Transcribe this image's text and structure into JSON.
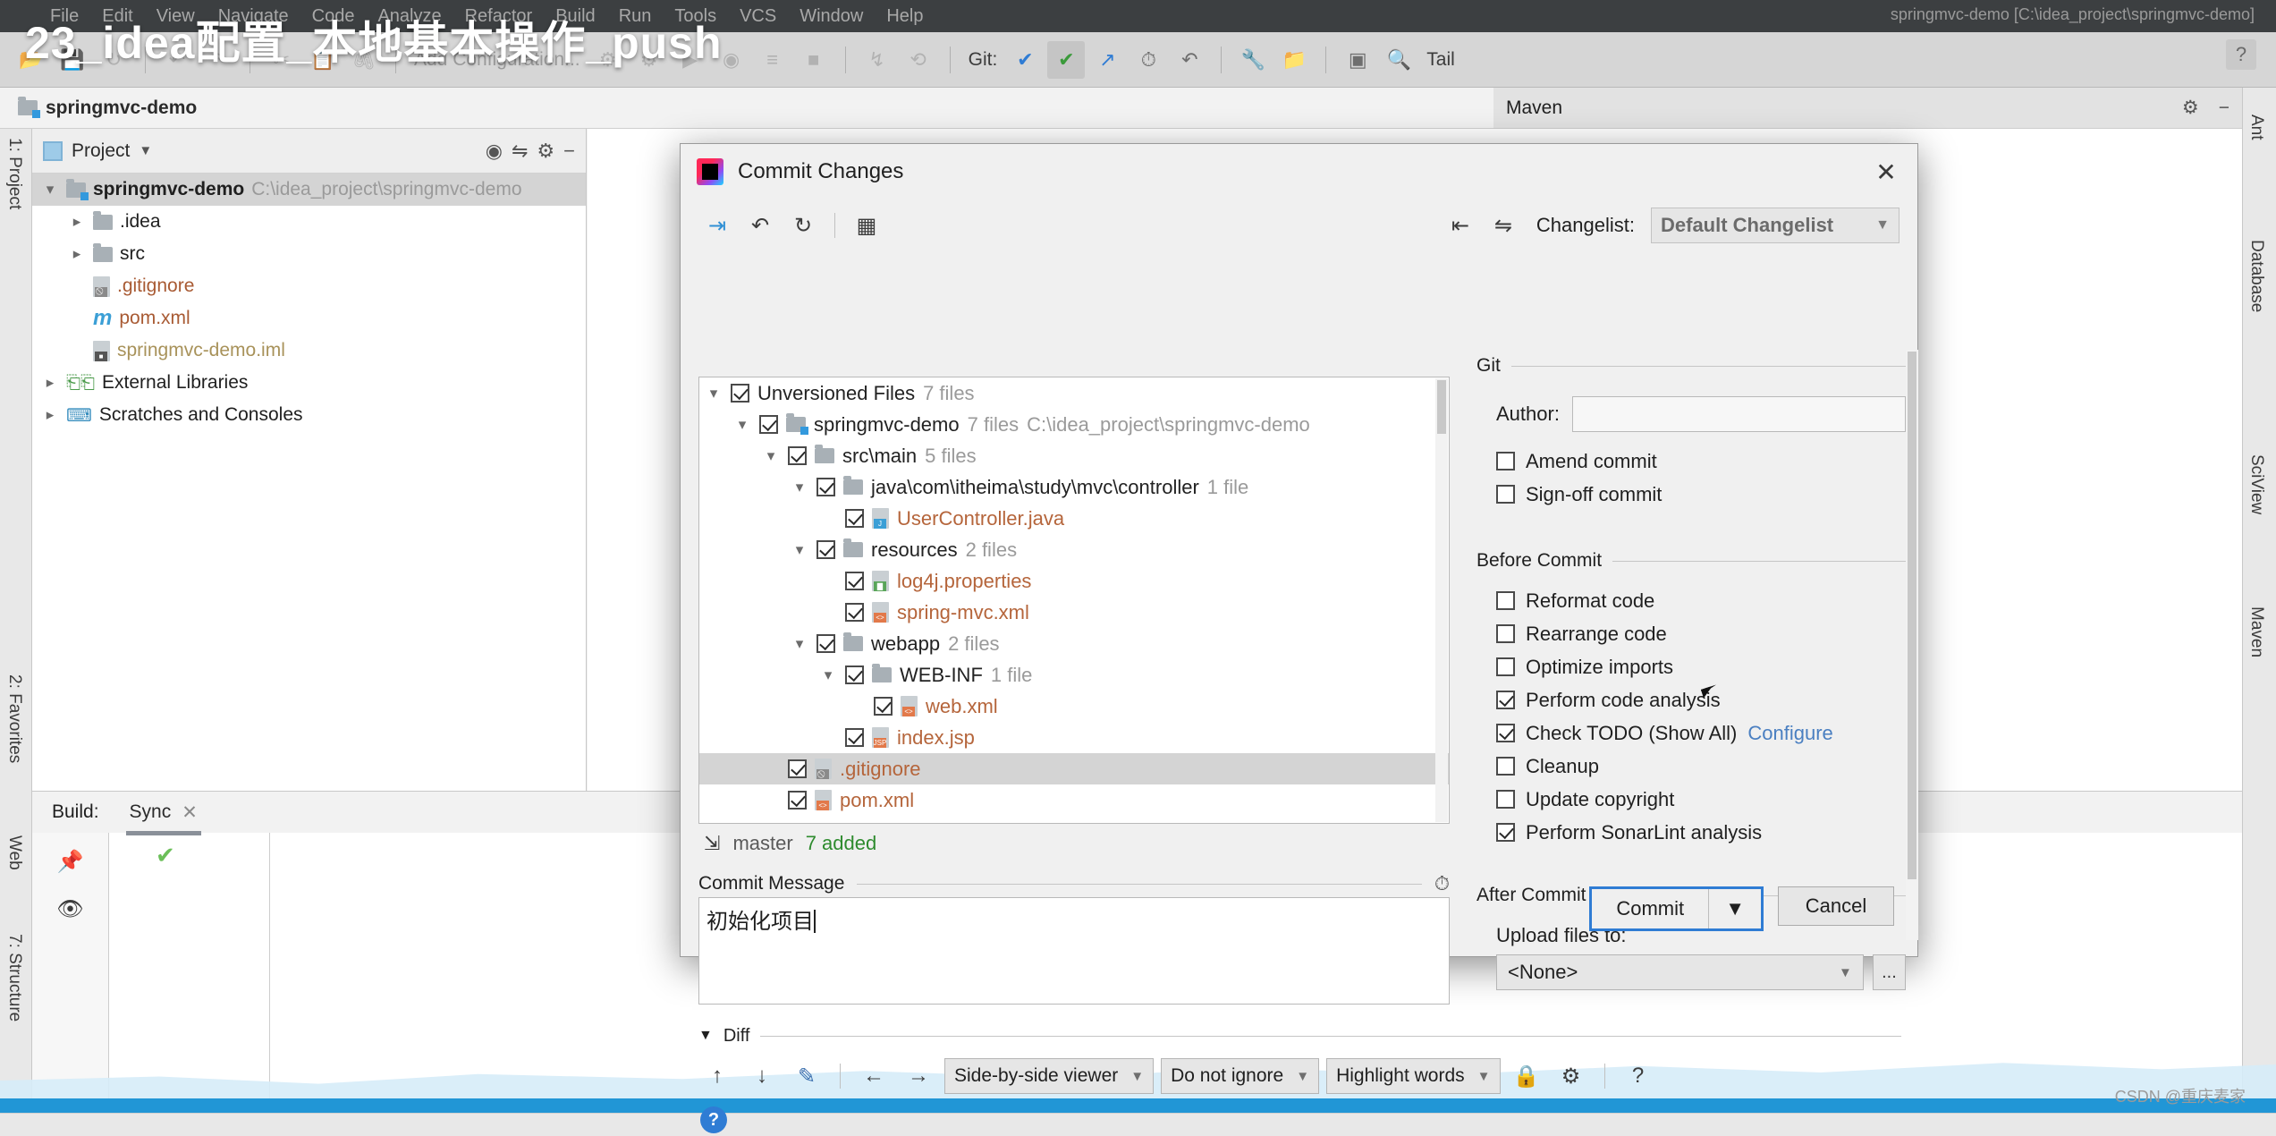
{
  "video": {
    "title": "23_idea配置_本地基本操作_push"
  },
  "ide": {
    "menu": [
      "File",
      "Edit",
      "View",
      "Navigate",
      "Code",
      "Analyze",
      "Refactor",
      "Build",
      "Run",
      "Tools",
      "VCS",
      "Window",
      "Help"
    ],
    "window_title": "springmvc-demo [C:\\idea_project\\springmvc-demo]",
    "toolbar": {
      "git_label": "Git:",
      "tail_label": "Tail",
      "run_config": "Add Configuration..."
    },
    "breadcrumb": "springmvc-demo",
    "maven_panel_title": "Maven",
    "left_strip": [
      "1: Project",
      "2: Favorites",
      "Web",
      "7: Structure"
    ],
    "right_strip": [
      "Ant",
      "Database",
      "SciView",
      "Maven"
    ],
    "project": {
      "panel_title": "Project",
      "nodes": [
        {
          "label": "springmvc-demo",
          "hint": "C:\\idea_project\\springmvc-demo",
          "icon": "folder-module",
          "indent": 0,
          "caret": "v",
          "selected": true,
          "bold": true
        },
        {
          "label": ".idea",
          "hint": "",
          "icon": "folder",
          "indent": 1,
          "caret": ">",
          "selected": false,
          "bold": false
        },
        {
          "label": "src",
          "hint": "",
          "icon": "folder",
          "indent": 1,
          "caret": ">",
          "selected": false,
          "bold": false
        },
        {
          "label": ".gitignore",
          "hint": "",
          "icon": "file-gitignore",
          "indent": 1,
          "caret": "",
          "selected": false,
          "bold": false
        },
        {
          "label": "pom.xml",
          "hint": "",
          "icon": "file-maven",
          "indent": 1,
          "caret": "",
          "selected": false,
          "bold": false
        },
        {
          "label": "springmvc-demo.iml",
          "hint": "",
          "icon": "file-iml",
          "indent": 1,
          "caret": "",
          "selected": false,
          "bold": false
        },
        {
          "label": "External Libraries",
          "hint": "",
          "icon": "libraries",
          "indent": 0,
          "caret": ">",
          "selected": false,
          "bold": false
        },
        {
          "label": "Scratches and Consoles",
          "hint": "",
          "icon": "scratches",
          "indent": 0,
          "caret": ">",
          "selected": false,
          "bold": false
        }
      ]
    },
    "build": {
      "label": "Build:",
      "tab": "Sync"
    },
    "watermark": "CSDN @重庆麦家"
  },
  "dialog": {
    "title": "Commit Changes",
    "changelist_label": "Changelist:",
    "changelist_value": "Default Changelist",
    "tree": [
      {
        "caret": "v",
        "checked": true,
        "indent": 0,
        "icon": "",
        "label": "Unversioned Files",
        "count": "7 files",
        "path": "",
        "selected": false,
        "color": "dark"
      },
      {
        "caret": "v",
        "checked": true,
        "indent": 1,
        "icon": "folder-module",
        "label": "springmvc-demo",
        "count": "7 files",
        "path": "C:\\idea_project\\springmvc-demo",
        "selected": false,
        "color": "dark"
      },
      {
        "caret": "v",
        "checked": true,
        "indent": 2,
        "icon": "folder",
        "label": "src\\main",
        "count": "5 files",
        "path": "",
        "selected": false,
        "color": "dark"
      },
      {
        "caret": "v",
        "checked": true,
        "indent": 3,
        "icon": "folder",
        "label": "java\\com\\itheima\\study\\mvc\\controller",
        "count": "1 file",
        "path": "",
        "selected": false,
        "color": "dark"
      },
      {
        "caret": "",
        "checked": true,
        "indent": 4,
        "icon": "file-java",
        "label": "UserController.java",
        "count": "",
        "path": "",
        "selected": false,
        "color": "orange"
      },
      {
        "caret": "v",
        "checked": true,
        "indent": 3,
        "icon": "folder",
        "label": "resources",
        "count": "2 files",
        "path": "",
        "selected": false,
        "color": "dark"
      },
      {
        "caret": "",
        "checked": true,
        "indent": 4,
        "icon": "file-properties",
        "label": "log4j.properties",
        "count": "",
        "path": "",
        "selected": false,
        "color": "orange"
      },
      {
        "caret": "",
        "checked": true,
        "indent": 4,
        "icon": "file-xml",
        "label": "spring-mvc.xml",
        "count": "",
        "path": "",
        "selected": false,
        "color": "orange"
      },
      {
        "caret": "v",
        "checked": true,
        "indent": 3,
        "icon": "folder",
        "label": "webapp",
        "count": "2 files",
        "path": "",
        "selected": false,
        "color": "dark"
      },
      {
        "caret": "v",
        "checked": true,
        "indent": 4,
        "icon": "folder",
        "label": "WEB-INF",
        "count": "1 file",
        "path": "",
        "selected": false,
        "color": "dark"
      },
      {
        "caret": "",
        "checked": true,
        "indent": 5,
        "icon": "file-xml",
        "label": "web.xml",
        "count": "",
        "path": "",
        "selected": false,
        "color": "orange"
      },
      {
        "caret": "",
        "checked": true,
        "indent": 4,
        "icon": "file-jsp",
        "label": "index.jsp",
        "count": "",
        "path": "",
        "selected": false,
        "color": "orange"
      },
      {
        "caret": "",
        "checked": true,
        "indent": 2,
        "icon": "file-gitignore",
        "label": ".gitignore",
        "count": "",
        "path": "",
        "selected": true,
        "color": "orange"
      },
      {
        "caret": "",
        "checked": true,
        "indent": 2,
        "icon": "file-xml",
        "label": "pom.xml",
        "count": "",
        "path": "",
        "selected": false,
        "color": "orange"
      }
    ],
    "branch": "master",
    "added_status": "7 added",
    "commit_message_label": "Commit Message",
    "commit_message_value": "初始化项目",
    "git_group": {
      "title": "Git",
      "author_label": "Author:",
      "author_value": "",
      "checkboxes": [
        {
          "label": "Amend commit",
          "checked": false
        },
        {
          "label": "Sign-off commit",
          "checked": false
        }
      ]
    },
    "before_commit": {
      "title": "Before Commit",
      "checkboxes": [
        {
          "label": "Reformat code",
          "checked": false,
          "link": ""
        },
        {
          "label": "Rearrange code",
          "checked": false,
          "link": ""
        },
        {
          "label": "Optimize imports",
          "checked": false,
          "link": ""
        },
        {
          "label": "Perform code analysis",
          "checked": true,
          "link": ""
        },
        {
          "label": "Check TODO (Show All)",
          "checked": true,
          "link": "Configure"
        },
        {
          "label": "Cleanup",
          "checked": false,
          "link": ""
        },
        {
          "label": "Update copyright",
          "checked": false,
          "link": ""
        },
        {
          "label": "Perform SonarLint analysis",
          "checked": true,
          "link": ""
        }
      ]
    },
    "after_commit": {
      "title": "After Commit",
      "upload_label": "Upload files to:",
      "upload_value": "<None>",
      "browse_label": "..."
    },
    "diff": {
      "title": "Diff",
      "viewer_mode": "Side-by-side viewer",
      "ignore_mode": "Do not ignore",
      "highlight_mode": "Highlight words"
    },
    "buttons": {
      "commit": "Commit",
      "cancel": "Cancel"
    }
  }
}
